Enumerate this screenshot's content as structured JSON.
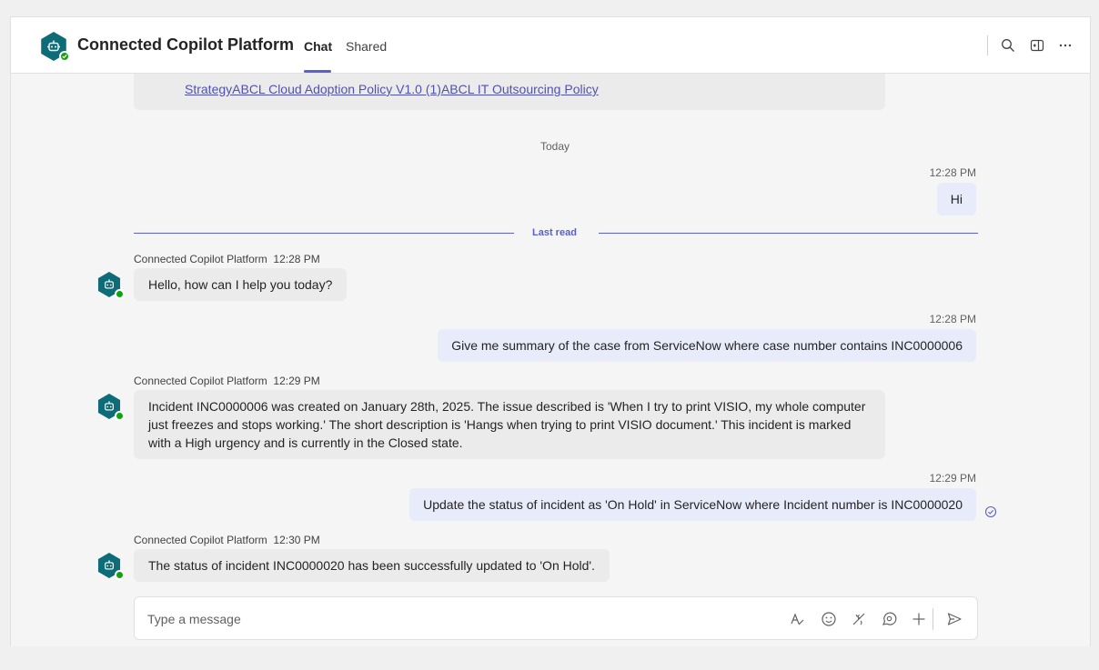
{
  "header": {
    "title": "Connected Copilot Platform",
    "tabs": [
      {
        "label": "Chat"
      },
      {
        "label": "Shared"
      }
    ]
  },
  "messages": {
    "prev_card_link": "StrategyABCL Cloud Adoption Policy V1.0 (1)ABCL IT Outsourcing Policy",
    "date_divider": "Today",
    "last_read": "Last read",
    "items": [
      {
        "sender": "",
        "time": "12:28 PM",
        "text": "Hi"
      },
      {
        "sender": "Connected Copilot Platform",
        "time": "12:28 PM",
        "text": "Hello, how can I help you today?"
      },
      {
        "sender": "",
        "time": "12:28 PM",
        "text": "Give me summary of the case from ServiceNow where case number contains INC0000006"
      },
      {
        "sender": "Connected Copilot Platform",
        "time": "12:29 PM",
        "text": "Incident INC0000006 was created on January 28th, 2025. The issue described is 'When I try to print VISIO, my whole computer just freezes and stops working.' The short description is 'Hangs when trying to print VISIO document.' This incident is marked with a High urgency and is currently in the Closed state."
      },
      {
        "sender": "",
        "time": "12:29 PM",
        "text": "Update the status of incident as 'On Hold' in ServiceNow where Incident number is INC0000020"
      },
      {
        "sender": "Connected Copilot Platform",
        "time": "12:30 PM",
        "text": "The status of incident INC0000020 has been successfully updated to 'On Hold'."
      }
    ]
  },
  "composer": {
    "placeholder": "Type a message"
  },
  "colors": {
    "accent": "#5b5fc7",
    "bot_avatar": "#0e6b78",
    "presence": "#13a10e",
    "outgoing_bubble": "#e8ebfa",
    "incoming_bubble": "#ebebeb"
  },
  "icons": {
    "header": [
      "search-icon",
      "pop-out-icon",
      "more-icon"
    ],
    "composer": [
      "format-icon",
      "emoji-icon",
      "sticker-icon",
      "loop-icon",
      "add-icon",
      "send-icon"
    ],
    "message_status": "seen-check-icon"
  }
}
